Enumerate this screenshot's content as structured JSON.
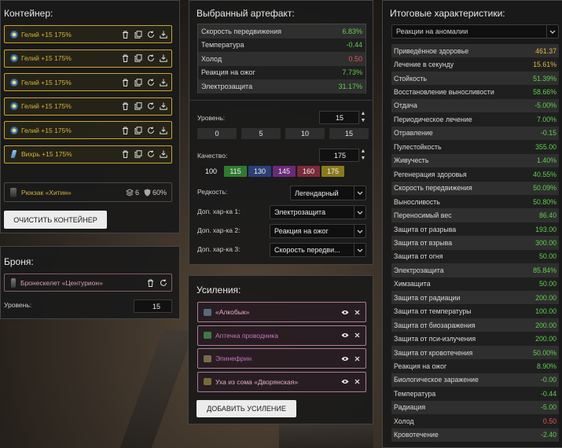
{
  "container": {
    "title": "Контейнер:",
    "items": [
      {
        "name": "Гелий +15 175%",
        "icon": "gelium-icon"
      },
      {
        "name": "Гелий +15 175%",
        "icon": "gelium-icon"
      },
      {
        "name": "Гелий +15 175%",
        "icon": "gelium-icon"
      },
      {
        "name": "Гелий +15 175%",
        "icon": "gelium-icon"
      },
      {
        "name": "Гелий +15 175%",
        "icon": "gelium-icon"
      },
      {
        "name": "Вихрь +15 175%",
        "icon": "vortex-icon"
      }
    ],
    "backpack": {
      "name": "Рюкзак «Хитин»",
      "capacity": "6",
      "protection": "60%"
    },
    "clear_label": "ОЧИСТИТЬ КОНТЕЙНЕР"
  },
  "armor": {
    "title": "Броня:",
    "item": "Бронескелет «Центурион»",
    "level_label": "Уровень:",
    "level_value": "15"
  },
  "artifact": {
    "title": "Выбранный артефакт:",
    "stats": [
      {
        "name": "Скорость передвижения",
        "value": "6.83%",
        "color": "g"
      },
      {
        "name": "Температура",
        "value": "-0.44",
        "color": "g"
      },
      {
        "name": "Холод",
        "value": "0.50",
        "color": "r"
      },
      {
        "name": "Реакция на ожог",
        "value": "7.73%",
        "color": "g"
      },
      {
        "name": "Электрозащита",
        "value": "31.17%",
        "color": "g"
      }
    ],
    "level_label": "Уровень:",
    "level_value": "15",
    "level_presets": [
      "0",
      "5",
      "10",
      "15"
    ],
    "quality_label": "Качество:",
    "quality_value": "175",
    "quality_presets": [
      {
        "label": "100",
        "color": "#1a1a1a"
      },
      {
        "label": "115",
        "color": "#2f7a32"
      },
      {
        "label": "130",
        "color": "#2b3f78"
      },
      {
        "label": "145",
        "color": "#6a2a78"
      },
      {
        "label": "160",
        "color": "#7a2a3a"
      },
      {
        "label": "175",
        "color": "#8a7a1c"
      }
    ],
    "rarity_label": "Редкость:",
    "rarity_value": "Легендарный",
    "extra1_label": "Доп. хар-ка 1:",
    "extra1_value": "Электрозащита",
    "extra2_label": "Доп. хар-ка 2:",
    "extra2_value": "Реакция на ожог",
    "extra3_label": "Доп. хар-ка 3:",
    "extra3_value": "Скорость передви..."
  },
  "boosts": {
    "title": "Усиления:",
    "items": [
      {
        "name": "«Алкобык»",
        "color": "#e2b0c8"
      },
      {
        "name": "Аптечка проводника",
        "color": "#c674c0"
      },
      {
        "name": "Эпинефрин",
        "color": "#c674c0"
      },
      {
        "name": "Уха из сома «Дворянская»",
        "color": "#e2b0c8"
      }
    ],
    "add_label": "ДОБАВИТЬ УСИЛЕНИЕ"
  },
  "totals": {
    "title": "Итоговые характеристики:",
    "filter_value": "Реакции на аномалии",
    "stats": [
      {
        "name": "Приведённое здоровье",
        "value": "461.37",
        "color": "o"
      },
      {
        "name": "Лечение в секунду",
        "value": "15.61%",
        "color": "o"
      },
      {
        "name": "Стойкость",
        "value": "51.39%",
        "color": "g"
      },
      {
        "name": "Восстановление выносливости",
        "value": "58.66%",
        "color": "g"
      },
      {
        "name": "Отдача",
        "value": "-5.00%",
        "color": "g"
      },
      {
        "name": "Периодическое лечение",
        "value": "7.00%",
        "color": "g"
      },
      {
        "name": "Отравление",
        "value": "-0.15",
        "color": "g"
      },
      {
        "name": "Пулестойкость",
        "value": "355.00",
        "color": "g"
      },
      {
        "name": "Живучесть",
        "value": "1.40%",
        "color": "g"
      },
      {
        "name": "Регенерация здоровья",
        "value": "40.55%",
        "color": "g"
      },
      {
        "name": "Скорость передвижения",
        "value": "50.09%",
        "color": "g"
      },
      {
        "name": "Выносливость",
        "value": "50.80%",
        "color": "g"
      },
      {
        "name": "Переносимый вес",
        "value": "86.40",
        "color": "g"
      },
      {
        "name": "Защита от разрыва",
        "value": "193.00",
        "color": "g"
      },
      {
        "name": "Защита от взрыва",
        "value": "300.00",
        "color": "g"
      },
      {
        "name": "Защита от огня",
        "value": "50.00",
        "color": "g"
      },
      {
        "name": "Электрозащита",
        "value": "85.84%",
        "color": "g"
      },
      {
        "name": "Химзащита",
        "value": "50.00",
        "color": "g"
      },
      {
        "name": "Защита от радиации",
        "value": "200.00",
        "color": "g"
      },
      {
        "name": "Защита от температуры",
        "value": "100.00",
        "color": "g"
      },
      {
        "name": "Защита от биозаражения",
        "value": "200.00",
        "color": "g"
      },
      {
        "name": "Защита от пси-излучения",
        "value": "200.00",
        "color": "g"
      },
      {
        "name": "Защита от кровотечения",
        "value": "50.00%",
        "color": "g"
      },
      {
        "name": "Реакция на ожог",
        "value": "8.90%",
        "color": "g"
      },
      {
        "name": "Биологическое заражение",
        "value": "-0.00",
        "color": "g"
      },
      {
        "name": "Температура",
        "value": "-0.44",
        "color": "g"
      },
      {
        "name": "Радиация",
        "value": "-5.00",
        "color": "g"
      },
      {
        "name": "Холод",
        "value": "0.50",
        "color": "r"
      },
      {
        "name": "Кровотечение",
        "value": "-2.40",
        "color": "g"
      }
    ]
  }
}
